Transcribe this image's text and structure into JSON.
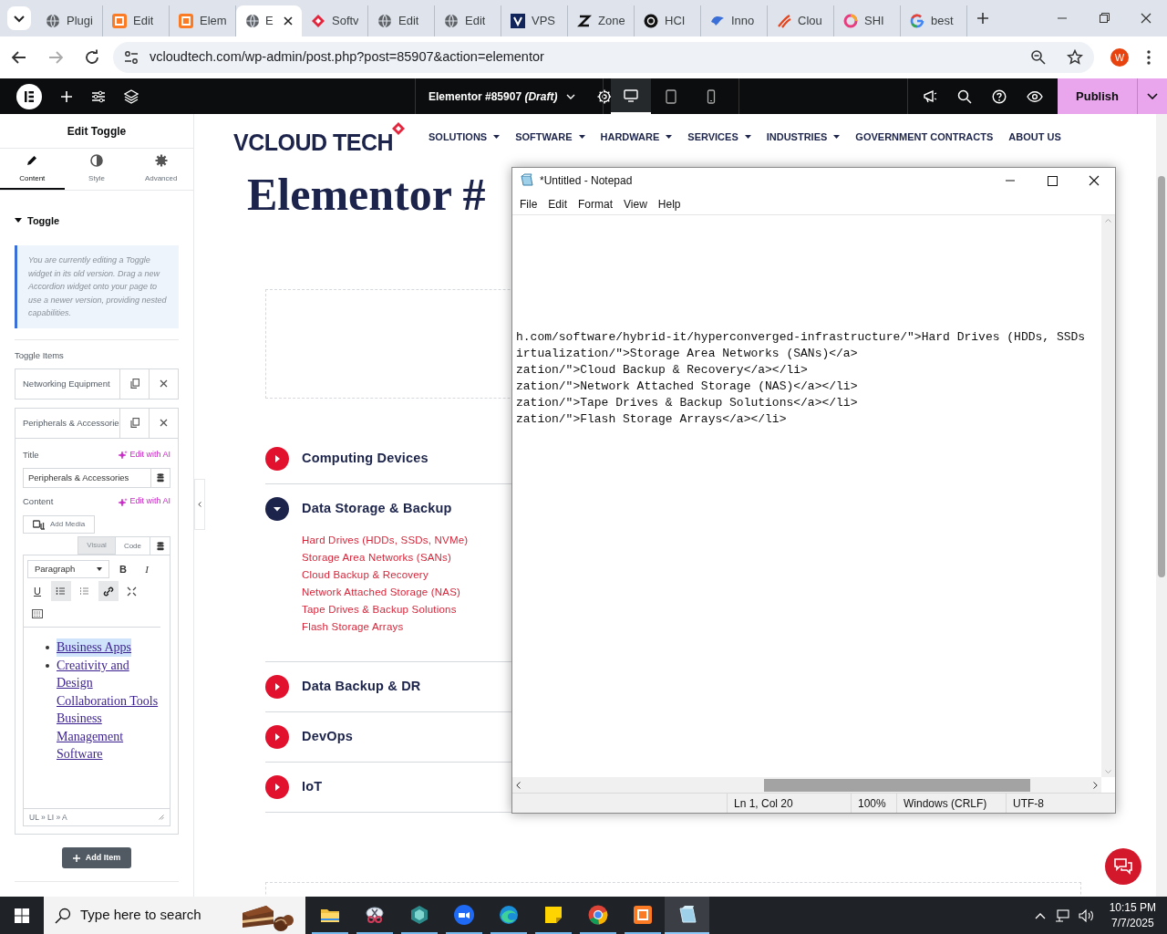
{
  "browser": {
    "tabs": [
      {
        "kind": "globe",
        "label": "Plugi",
        "selected": false
      },
      {
        "kind": "xampp",
        "label": "Edit",
        "selected": false
      },
      {
        "kind": "xampp",
        "label": "Elem",
        "selected": false
      },
      {
        "kind": "globe",
        "label": "E",
        "selected": true
      },
      {
        "kind": "diamond",
        "label": "Softv",
        "selected": false
      },
      {
        "kind": "globe",
        "label": "Edit",
        "selected": false
      },
      {
        "kind": "globe",
        "label": "Edit",
        "selected": false
      },
      {
        "kind": "navy",
        "label": "VPS",
        "selected": false
      },
      {
        "kind": "zigzag",
        "label": "Zone",
        "selected": false
      },
      {
        "kind": "hci",
        "label": "HCI",
        "selected": false
      },
      {
        "kind": "bird",
        "label": "Inno",
        "selected": false
      },
      {
        "kind": "slash",
        "label": "Clou",
        "selected": false
      },
      {
        "kind": "ring",
        "label": "SHI",
        "selected": false
      },
      {
        "kind": "google",
        "label": "best",
        "selected": false
      }
    ],
    "url": "vcloudtech.com/wp-admin/post.php?post=85907&action=elementor",
    "profile": "W"
  },
  "editor_bar": {
    "document": "Elementor #85907 *(Draft)*",
    "devices": [
      {
        "kind": "desktop",
        "selected": true
      },
      {
        "kind": "tablet",
        "selected": false
      },
      {
        "kind": "mobile",
        "selected": false
      }
    ],
    "publish": "Publish"
  },
  "panel": {
    "title": "Edit Toggle",
    "tabs": [
      {
        "kind": "pencil",
        "label": "Content",
        "selected": true
      },
      {
        "kind": "contrast",
        "label": "Style",
        "selected": false
      },
      {
        "kind": "gear",
        "label": "Advanced",
        "selected": false
      }
    ],
    "section": {
      "title": "Toggle",
      "expanded": true
    },
    "notice": "You are currently editing a Toggle widget in its old version. Drag a new Accordion widget onto your page to use a newer version, providing nested capabilities.",
    "items_label": "Toggle Items",
    "items": [
      {
        "title": "Networking Equipment",
        "expanded": false
      },
      {
        "title": "Peripherals & Accessorie",
        "expanded": true
      }
    ],
    "title_label": "Title",
    "title_ai": "Edit with AI",
    "title_value": "Peripherals & Accessories",
    "content_label": "Content",
    "content_ai": "Edit with AI",
    "add_media": "Add Media",
    "editor_tabs": [
      {
        "label": "Visual",
        "selected": true
      },
      {
        "label": "Code",
        "selected": false
      }
    ],
    "format": "Paragraph",
    "toolbar": [
      {
        "kind": "bold",
        "label": "B",
        "active": false
      },
      {
        "kind": "italic",
        "label": "I",
        "active": false
      },
      {
        "kind": "underline",
        "label": "U",
        "active": false
      },
      {
        "kind": "bullets",
        "active": true
      },
      {
        "kind": "numbers",
        "active": false
      },
      {
        "kind": "link",
        "active": true
      },
      {
        "kind": "fullscreen",
        "active": false
      },
      {
        "kind": "keyboard",
        "active": false
      }
    ],
    "list": [
      {
        "links": [
          {
            "text": "Business Apps",
            "selected": true
          }
        ]
      },
      {
        "links": [
          {
            "text": "Creativity and Design",
            "selected": false
          },
          {
            "text": "Collaboration Tools",
            "selected": false
          },
          {
            "text": "Business Management Software",
            "selected": false
          }
        ]
      }
    ],
    "path": "UL » LI » A",
    "add_item": "Add Item"
  },
  "site": {
    "logo": "VCLOUD TECH",
    "nav": [
      {
        "label": "SOLUTIONS",
        "dropdown": true
      },
      {
        "label": "SOFTWARE",
        "dropdown": true
      },
      {
        "label": "HARDWARE",
        "dropdown": true
      },
      {
        "label": "SERVICES",
        "dropdown": true
      },
      {
        "label": "INDUSTRIES",
        "dropdown": true
      },
      {
        "label": "GOVERNMENT CONTRACTS",
        "dropdown": false
      },
      {
        "label": "ABOUT US",
        "dropdown": false
      }
    ],
    "heading": "Elementor #",
    "toggles": [
      {
        "title": "Computing Devices",
        "expanded": false
      },
      {
        "title": "Data Storage & Backup",
        "expanded": true,
        "links": [
          "Hard Drives (HDDs, SSDs, NVMe)",
          "Storage Area Networks (SANs)",
          "Cloud Backup & Recovery",
          "Network Attached Storage (NAS)",
          "Tape Drives & Backup Solutions",
          "Flash Storage Arrays"
        ]
      },
      {
        "title": "Data Backup & DR",
        "expanded": false
      },
      {
        "title": "DevOps",
        "expanded": false
      },
      {
        "title": "IoT",
        "expanded": false
      }
    ]
  },
  "notepad": {
    "title": "*Untitled - Notepad",
    "menu": [
      "File",
      "Edit",
      "Format",
      "View",
      "Help"
    ],
    "lines": [
      "h.com/software/hybrid-it/hyperconverged-infrastructure/\">Hard Drives (HDDs, SSDs",
      "irtualization/\">Storage Area Networks (SANs)</a>",
      "zation/\">Cloud Backup & Recovery</a></li>",
      "zation/\">Network Attached Storage (NAS)</a></li>",
      "zation/\">Tape Drives & Backup Solutions</a></li>",
      "zation/\">Flash Storage Arrays</a></li>"
    ],
    "status": [
      "Ln 1, Col 20",
      "100%",
      "Windows (CRLF)",
      "UTF-8"
    ]
  },
  "taskbar": {
    "search": "Type here to search",
    "apps": [
      {
        "kind": "folder",
        "running": true,
        "active": false
      },
      {
        "kind": "snip",
        "running": true,
        "active": false
      },
      {
        "kind": "gem",
        "running": true,
        "active": false
      },
      {
        "kind": "zoom",
        "running": true,
        "active": false
      },
      {
        "kind": "edge",
        "running": true,
        "active": false
      },
      {
        "kind": "sticky",
        "running": true,
        "active": false
      },
      {
        "kind": "chrome",
        "running": true,
        "active": false
      },
      {
        "kind": "xampp",
        "running": true,
        "active": false
      },
      {
        "kind": "notepad",
        "running": true,
        "active": true
      }
    ],
    "time": "10:15 PM",
    "date": "7/7/2025"
  }
}
